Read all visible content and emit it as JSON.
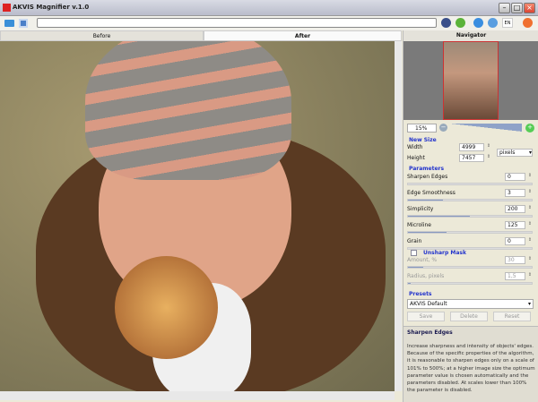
{
  "window": {
    "title": "AKVIS Magnifier v.1.0",
    "lang": "EN"
  },
  "tabs": {
    "before": "Before",
    "after": "After",
    "navigator": "Navigator"
  },
  "zoom": {
    "value": "15%",
    "slider_fraction": 0.1
  },
  "new_size": {
    "title": "New Size",
    "width_label": "Width",
    "width": "4999",
    "height_label": "Height",
    "height": "7457",
    "unit": "pixels"
  },
  "parameters": {
    "title": "Parameters",
    "items": [
      {
        "label": "Sharpen Edges",
        "value": "0",
        "fraction": 0
      },
      {
        "label": "Edge Smoothness",
        "value": "3",
        "fraction": 0.28
      },
      {
        "label": "Simplicity",
        "value": "200",
        "fraction": 0.5
      },
      {
        "label": "Microline",
        "value": "125",
        "fraction": 0.31
      },
      {
        "label": "Grain",
        "value": "0",
        "fraction": 0
      }
    ]
  },
  "unsharp": {
    "title": "Unsharp Mask",
    "amount_label": "Amount, %",
    "amount": "30",
    "amount_fraction": 0.12,
    "radius_label": "Radius, pixels",
    "radius": "1,5",
    "radius_fraction": 0.02
  },
  "presets": {
    "title": "Presets",
    "selected": "AKVIS Default",
    "save": "Save",
    "delete": "Delete",
    "reset": "Reset"
  },
  "help": {
    "title": "Sharpen Edges",
    "text": "Increase sharpness and intensity of objects' edges. Because of the specific properties of the algorithm, it is reasonable to sharpen edges only on a scale of 101% to 500%; at a higher image size the optimum parameter value is chosen automatically and the parameters disabled. At scales lower than 100% the parameter is disabled."
  }
}
